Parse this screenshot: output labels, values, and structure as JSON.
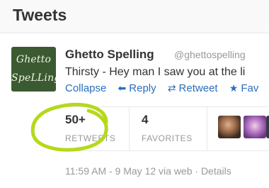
{
  "header": {
    "title": "Tweets"
  },
  "tweet": {
    "avatar_text_line1": "Ghetto",
    "avatar_text_line2": "SpeLLing",
    "name": "Ghetto Spelling",
    "handle": "@ghettospelling",
    "text": "Thirsty - Hey man I saw you at the li",
    "actions": {
      "collapse": "Collapse",
      "reply": "Reply",
      "retweet": "Retweet",
      "favorite": "Fav"
    },
    "stats": {
      "retweets_count": "50+",
      "retweets_label": "RETWEETS",
      "favorites_count": "4",
      "favorites_label": "FAVORITES"
    },
    "meta": "11:59 AM - 9 May 12 via web · Details"
  },
  "annotation": {
    "color": "#b5d91a"
  },
  "icons": {
    "reply": "reply-arrow-icon",
    "retweet": "retweet-icon",
    "favorite": "star-icon"
  },
  "colors": {
    "link": "#2a6ebb",
    "muted": "#999999",
    "text": "#333333"
  }
}
